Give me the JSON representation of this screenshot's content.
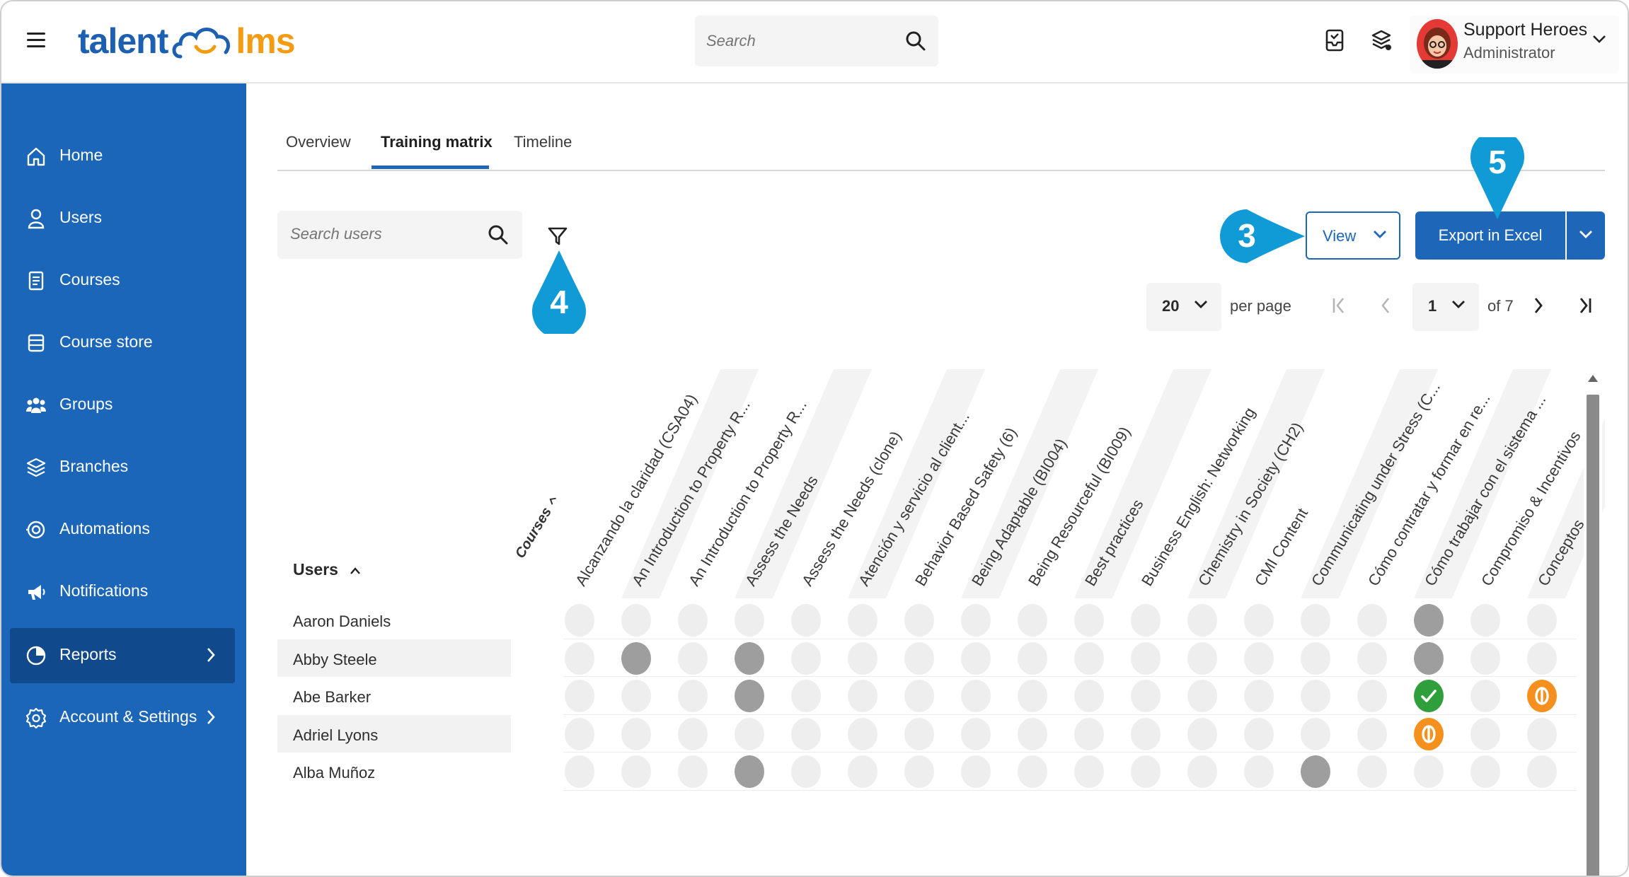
{
  "header": {
    "logo_left": "talent",
    "logo_right": "lms",
    "search_placeholder": "Search",
    "profile_name": "Support Heroes",
    "profile_role": "Administrator"
  },
  "sidebar": {
    "items": [
      {
        "label": "Home",
        "icon": "home-icon"
      },
      {
        "label": "Users",
        "icon": "user-icon"
      },
      {
        "label": "Courses",
        "icon": "courses-icon"
      },
      {
        "label": "Course store",
        "icon": "course-store-icon"
      },
      {
        "label": "Groups",
        "icon": "groups-icon"
      },
      {
        "label": "Branches",
        "icon": "branches-icon"
      },
      {
        "label": "Automations",
        "icon": "automations-icon"
      },
      {
        "label": "Notifications",
        "icon": "notifications-icon"
      },
      {
        "label": "Reports",
        "icon": "reports-icon",
        "active": true
      },
      {
        "label": "Account & Settings",
        "icon": "settings-icon"
      }
    ]
  },
  "tabs": [
    {
      "label": "Overview"
    },
    {
      "label": "Training matrix",
      "active": true
    },
    {
      "label": "Timeline"
    }
  ],
  "toolbar": {
    "search_placeholder": "Search users",
    "view_label": "View",
    "export_label": "Export in Excel"
  },
  "pagination": {
    "per_page": "20",
    "per_page_label": "per page",
    "current_page": "1",
    "of_pages": "of 7"
  },
  "callouts": [
    "3",
    "4",
    "5"
  ],
  "matrix": {
    "axis_label": "Courses",
    "users_header": "Users",
    "courses": [
      "Alcanzando la claridad (CSA04)",
      "An Introduction to Property R...",
      "An Introduction to Property R...",
      "Assess the Needs",
      "Assess the Needs (clone)",
      "Atención y servicio al client...",
      "Behavior Based Safety (6)",
      "Being Adaptable (BI004)",
      "Being Resourceful (BI009)",
      "Best practices",
      "Business English: Networking",
      "Chemistry in Society (CH2)",
      "CMI Content",
      "Communicating under Stress (C...",
      "Cómo contratar y formar en re...",
      "Cómo trabajar con el sistema ...",
      "Compromiso & Incentivos",
      "Conceptos"
    ],
    "users": [
      {
        "name": "Aaron Daniels",
        "status": [
          "e",
          "e",
          "e",
          "e",
          "e",
          "e",
          "e",
          "e",
          "e",
          "e",
          "e",
          "e",
          "e",
          "e",
          "e",
          "d",
          "e",
          "e"
        ]
      },
      {
        "name": "Abby Steele",
        "status": [
          "e",
          "d",
          "e",
          "d",
          "e",
          "e",
          "e",
          "e",
          "e",
          "e",
          "e",
          "e",
          "e",
          "e",
          "e",
          "d",
          "e",
          "e"
        ]
      },
      {
        "name": "Abe Barker",
        "status": [
          "e",
          "e",
          "e",
          "d",
          "e",
          "e",
          "e",
          "e",
          "e",
          "e",
          "e",
          "e",
          "e",
          "e",
          "e",
          "c",
          "e",
          "p"
        ]
      },
      {
        "name": "Adriel Lyons",
        "status": [
          "e",
          "e",
          "e",
          "e",
          "e",
          "e",
          "e",
          "e",
          "e",
          "e",
          "e",
          "e",
          "e",
          "e",
          "e",
          "p",
          "e",
          "e"
        ]
      },
      {
        "name": "Alba Muñoz",
        "status": [
          "e",
          "e",
          "e",
          "d",
          "e",
          "e",
          "e",
          "e",
          "e",
          "e",
          "e",
          "e",
          "e",
          "d",
          "e",
          "e",
          "e",
          "e"
        ]
      }
    ]
  },
  "colors": {
    "sidebar": "#1b66b8",
    "sidebar_active": "#114a8c",
    "accent": "#1d66b8",
    "callout": "#109bd6",
    "completed": "#2e9f3b",
    "in_progress": "#f5901e",
    "not_started": "#9e9e9e",
    "not_assigned": "#eeeeee"
  }
}
